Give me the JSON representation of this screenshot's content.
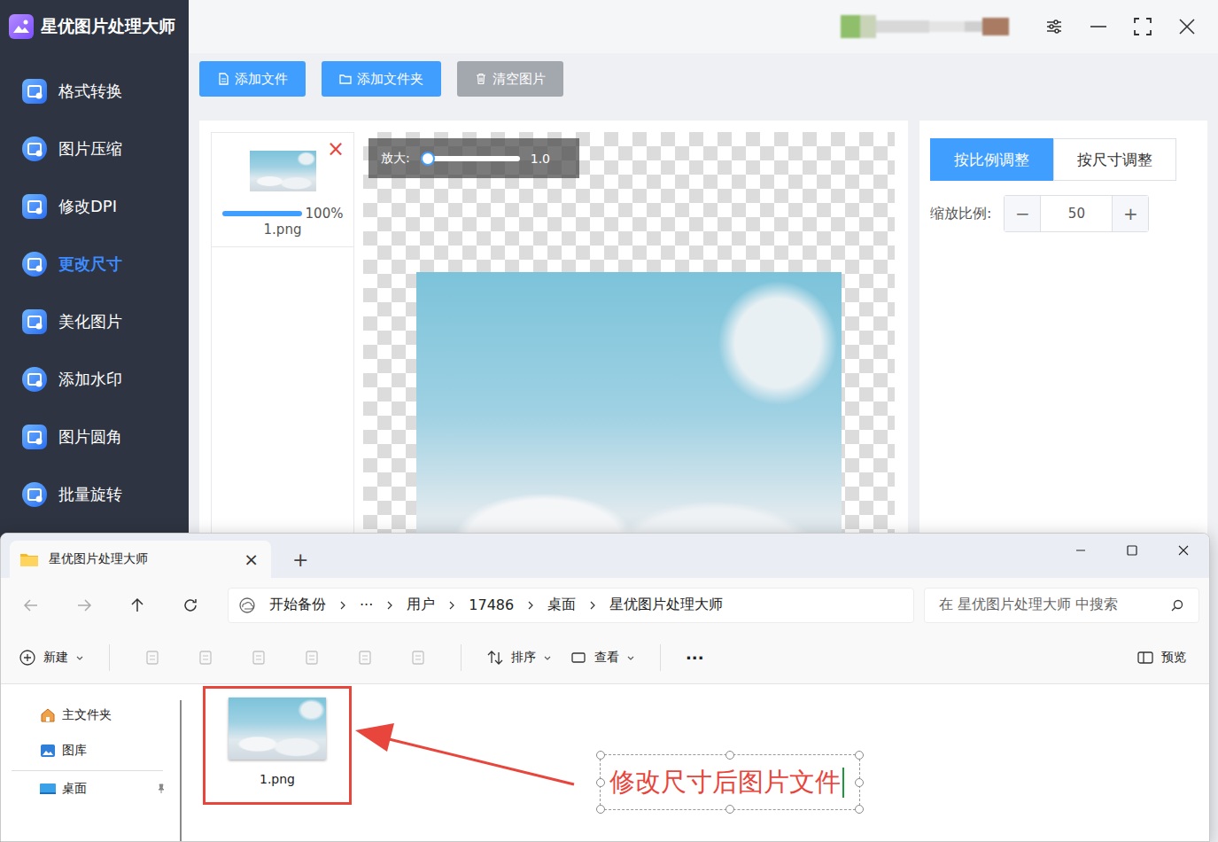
{
  "app": {
    "title": "星优图片处理大师"
  },
  "sidebar": {
    "items": [
      {
        "label": "格式转换",
        "selected": false
      },
      {
        "label": "图片压缩",
        "selected": false
      },
      {
        "label": "修改DPI",
        "selected": false
      },
      {
        "label": "更改尺寸",
        "selected": true
      },
      {
        "label": "美化图片",
        "selected": false
      },
      {
        "label": "添加水印",
        "selected": false
      },
      {
        "label": "图片圆角",
        "selected": false
      },
      {
        "label": "批量旋转",
        "selected": false
      }
    ]
  },
  "toolbar": {
    "buttons": [
      {
        "label": "添加文件",
        "kind": "primary"
      },
      {
        "label": "添加文件夹",
        "kind": "primary"
      },
      {
        "label": "清空图片",
        "kind": "muted"
      }
    ]
  },
  "files": [
    {
      "name": "1.png",
      "progress": "100%",
      "level": 1,
      "remove": "×"
    }
  ],
  "preview": {
    "zoom_label": "放大:",
    "zoom_level": 0,
    "zoom_reading": "1.0"
  },
  "resize": {
    "tabs": [
      {
        "label": "按比例调整",
        "selected": true
      },
      {
        "label": "按尺寸调整",
        "selected": false
      }
    ],
    "scale_label": "缩放比例:",
    "scale_value": "50",
    "decrement": "−",
    "increment": "+"
  },
  "explorer": {
    "tab_title": "星优图片处理大师",
    "tab_close": "×",
    "new_tab": "+",
    "breadcrumb": [
      "开始备份",
      "···",
      "用户",
      "17486",
      "桌面",
      "星优图片处理大师"
    ],
    "search_placeholder": "在 星优图片处理大师 中搜索",
    "commands": {
      "new": "新建",
      "sort": "排序",
      "view": "查看",
      "more": "···",
      "preview": "预览"
    },
    "nav": [
      {
        "label": "主文件夹",
        "pinned": false
      },
      {
        "label": "图库",
        "pinned": false
      },
      {
        "label": "桌面",
        "pinned": true
      }
    ],
    "files": [
      {
        "name": "1.png",
        "highlighted": true
      }
    ]
  },
  "annotation": {
    "text": "修改尺寸后图片文件"
  }
}
